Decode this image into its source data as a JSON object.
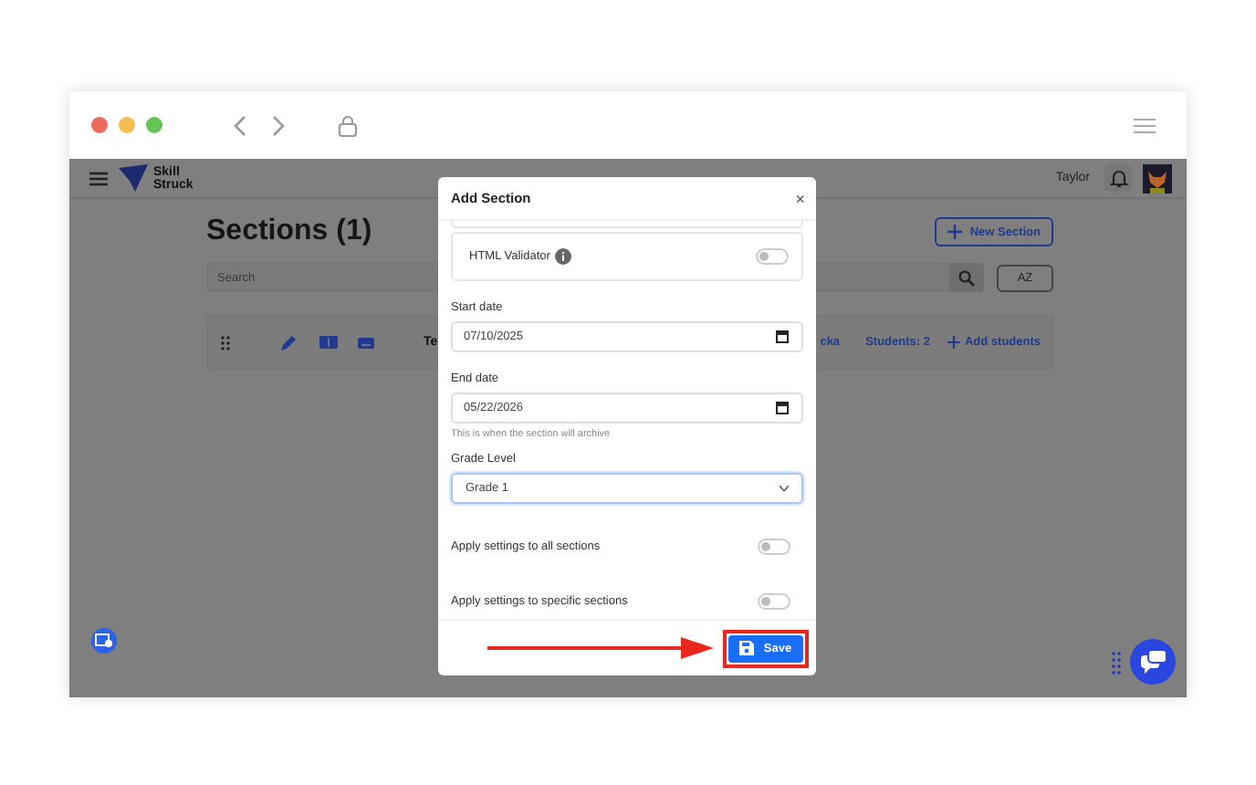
{
  "header": {
    "logo_lines": [
      "Skill",
      "Struck"
    ],
    "user_name": "Taylor"
  },
  "page": {
    "title": "Sections (1)",
    "new_section": "New Section",
    "search_placeholder": "Search",
    "sort_button": "AZ",
    "row": {
      "teacher_fragment": "Te",
      "cohort_fragment": "cka",
      "students": "Students: 2",
      "add_students": "Add students"
    }
  },
  "modal": {
    "title": "Add Section",
    "close": "×",
    "html_validator": {
      "label": "HTML Validator",
      "on": false
    },
    "start_date": {
      "label": "Start date",
      "value": "07/10/2025"
    },
    "end_date": {
      "label": "End date",
      "value": "05/22/2026",
      "hint": "This is when the section will archive"
    },
    "grade_level": {
      "label": "Grade Level",
      "value": "Grade 1"
    },
    "apply_settings": [
      {
        "label": "Apply settings to all sections",
        "on": false
      },
      {
        "label": "Apply settings to specific sections",
        "on": false
      }
    ],
    "save": "Save"
  }
}
